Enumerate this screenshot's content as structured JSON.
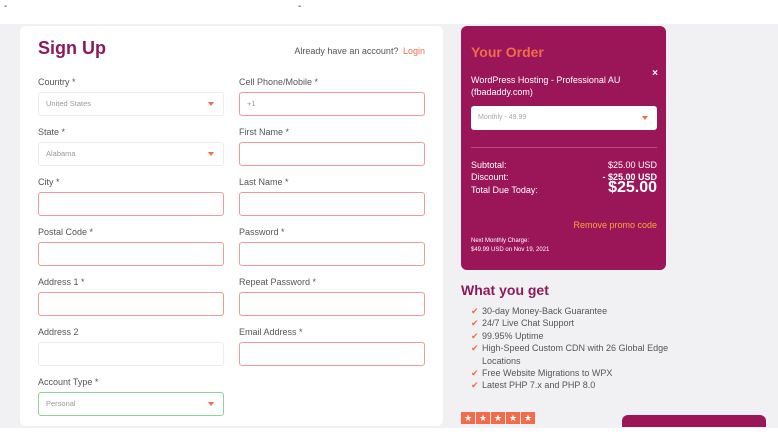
{
  "signup": {
    "title": "Sign Up",
    "already_text": "Already have an account?",
    "login_link": "Login",
    "fields": {
      "country": {
        "label": "Country *",
        "value": "United States"
      },
      "cell": {
        "label": "Cell Phone/Mobile *",
        "value": "+1"
      },
      "state": {
        "label": "State *",
        "value": "Alabama"
      },
      "first_name": {
        "label": "First Name *",
        "value": ""
      },
      "city": {
        "label": "City *",
        "value": ""
      },
      "last_name": {
        "label": "Last Name *",
        "value": ""
      },
      "postal": {
        "label": "Postal Code *",
        "value": ""
      },
      "password": {
        "label": "Password *",
        "value": ""
      },
      "address1": {
        "label": "Address 1 *",
        "value": ""
      },
      "repeat_password": {
        "label": "Repeat Password *",
        "value": ""
      },
      "address2": {
        "label": "Address 2",
        "value": ""
      },
      "email": {
        "label": "Email Address *",
        "value": ""
      },
      "account_type": {
        "label": "Account Type *",
        "value": "Personal"
      }
    }
  },
  "order": {
    "title": "Your Order",
    "product": "WordPress Hosting - Professional AU (fbadaddy.com)",
    "close": "×",
    "cycle": "Monthly - 49.99",
    "subtotal_label": "Subtotal:",
    "subtotal_value": "$25.00 USD",
    "discount_label": "Discount:",
    "discount_value": "- $25.00 USD",
    "total_label": "Total Due Today:",
    "total_value": "$25.00",
    "promo": "Remove promo code",
    "next_label": "Next Monthly Charge:",
    "next_value": "$49.99 USD on Nov 19, 2021"
  },
  "what_you_get": {
    "title": "What you get",
    "items": [
      "30-day Money-Back Guarantee",
      "24/7 Live Chat Support",
      "99.95% Uptime",
      "High-Speed Custom CDN with 26 Global Edge Locations",
      "Free Website Migrations to WPX",
      "Latest PHP 7.x and PHP 8.0"
    ]
  },
  "colors": {
    "brand": "#9b1659",
    "accent": "#f26b4a",
    "error_border": "#f29a9a",
    "valid_border": "#8fd39a"
  },
  "icons": {
    "check": "check-icon",
    "caret": "chevron-down-icon",
    "star": "star-icon",
    "close": "close-icon"
  }
}
